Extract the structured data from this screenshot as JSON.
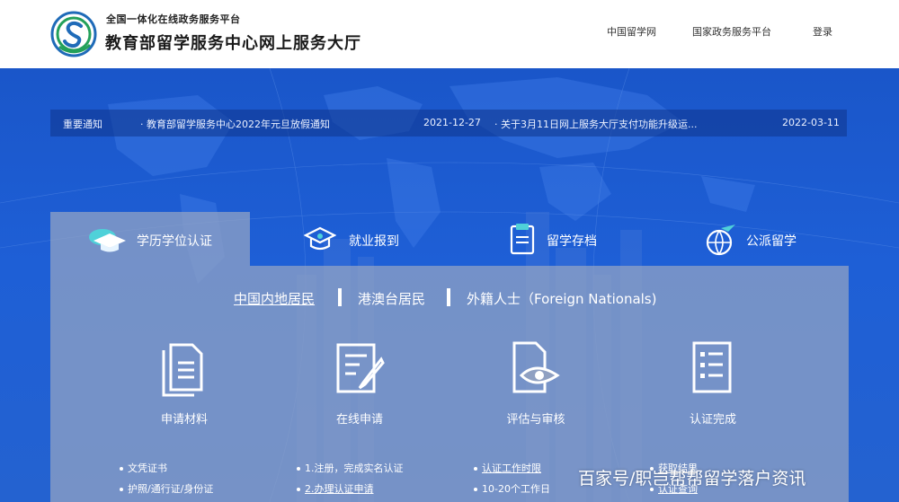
{
  "header": {
    "subtitle": "全国一体化在线政务服务平台",
    "title": "教育部留学服务中心网上服务大厅",
    "nav": [
      "中国留学网",
      "国家政务服务平台",
      "登录"
    ]
  },
  "notice": {
    "label": "重要通知",
    "items": [
      {
        "text": "· 教育部留学服务中心2022年元旦放假通知",
        "date": "2021-12-27"
      },
      {
        "text": "· 关于3月11日网上服务大厅支付功能升级运...",
        "date": "2022-03-11"
      }
    ]
  },
  "tabs": [
    {
      "label": "学历学位认证",
      "icon": "graduation-cap-icon",
      "active": true
    },
    {
      "label": "就业报到",
      "icon": "mortarboard-icon",
      "active": false
    },
    {
      "label": "留学存档",
      "icon": "document-folder-icon",
      "active": false
    },
    {
      "label": "公派留学",
      "icon": "globe-plane-icon",
      "active": false
    }
  ],
  "subtabs": [
    "中国内地居民",
    "港澳台居民",
    "外籍人士（Foreign Nationals)"
  ],
  "steps": [
    {
      "label": "申请材料",
      "icon": "documents-icon",
      "details": [
        "文凭证书",
        "护照/通行证/身份证"
      ]
    },
    {
      "label": "在线申请",
      "icon": "form-edit-icon",
      "details": [
        "1.注册，完成实名认证",
        "2.办理认证申请"
      ]
    },
    {
      "label": "评估与审核",
      "icon": "eye-document-icon",
      "details": [
        "认证工作时限",
        "10-20个工作日"
      ]
    },
    {
      "label": "认证完成",
      "icon": "checklist-icon",
      "details": [
        "获取结果",
        "认证查询"
      ]
    }
  ],
  "watermark": "百家号/职岂帮帮留学落户资讯",
  "colors": {
    "primary": "#1d56c8",
    "panel": "#96a5c3",
    "header_bg": "#ffffff"
  }
}
